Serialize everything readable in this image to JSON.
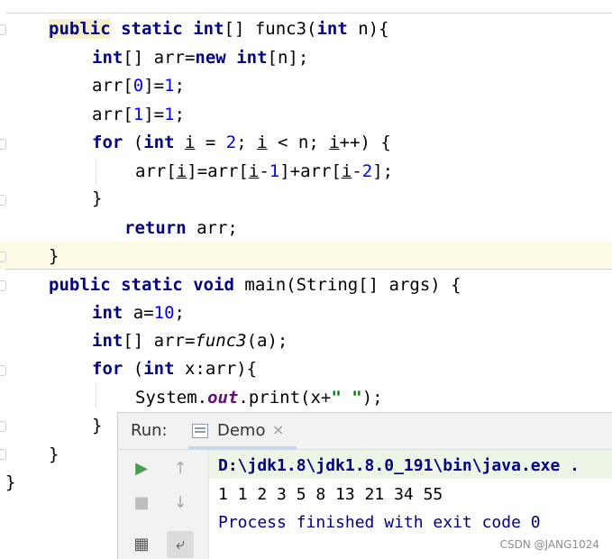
{
  "code": {
    "top_brace": "}",
    "func3_sig": {
      "kw1": "public",
      "kw2": "static",
      "kw3": "int",
      "rest1": "[] func3(",
      "kw4": "int",
      "rest2": " n){"
    },
    "line_arr_decl": {
      "kw1": "int",
      "mid": "[] arr=",
      "kw2": "new",
      "sp": " ",
      "kw3": "int",
      "rest": "[n];"
    },
    "line_arr0": {
      "pre": "arr[",
      "n1": "0",
      "mid": "]=",
      "n2": "1",
      "end": ";"
    },
    "line_arr1": {
      "pre": "arr[",
      "n1": "1",
      "mid": "]=",
      "n2": "1",
      "end": ";"
    },
    "line_for1": {
      "kw1": "for",
      "a": " (",
      "kw2": "int",
      "b": " ",
      "v1": "i",
      "c": " = ",
      "n1": "2",
      "d": "; ",
      "v2": "i",
      "e": " < n; ",
      "v3": "i",
      "f": "++) {"
    },
    "line_body": {
      "a": "arr[",
      "v1": "i",
      "b": "]=arr[",
      "v2": "i",
      "c": "-",
      "n1": "1",
      "d": "]+arr[",
      "v3": "i",
      "e": "-",
      "n2": "2",
      "f": "];"
    },
    "close1": "}",
    "line_return": {
      "kw": "return",
      "rest": " arr;"
    },
    "close2": "}",
    "main_sig": {
      "kw1": "public",
      "kw2": "static",
      "kw3": "void",
      "rest": " main(String[] args) {"
    },
    "line_a": {
      "kw": "int",
      "mid": " a=",
      "num": "10",
      "end": ";"
    },
    "line_call": {
      "kw": "int",
      "mid": "[] arr=",
      "fn": "func3",
      "end": "(a);"
    },
    "line_for2": {
      "kw1": "for",
      "a": " (",
      "kw2": "int",
      "b": " x:arr){"
    },
    "line_print": {
      "a": "System.",
      "field": "out",
      "b": ".print(x+",
      "str": "\" \"",
      "c": ");"
    },
    "close3": "}",
    "close4": "}",
    "close5": "}"
  },
  "run_panel": {
    "title": "Run:",
    "tab_label": "Demo",
    "tab_close": "×",
    "cmd_line": "D:\\jdk1.8\\jdk1.8.0_191\\bin\\java.exe .",
    "output_line": "1 1 2 3 5 8 13 21 34 55",
    "exit_line": "Process finished with exit code 0",
    "tools": {
      "rerun": "▶",
      "up": "↑",
      "stop": "■",
      "down": "↓",
      "layout": "▦",
      "wrap": "⤶"
    }
  },
  "watermark": "CSDN @JANG1024",
  "colors": {
    "keyword": "#000080",
    "number": "#0000ff",
    "string": "#008000",
    "field": "#660e7a",
    "highlight": "#fdfbe6",
    "run_green": "#499c54"
  }
}
